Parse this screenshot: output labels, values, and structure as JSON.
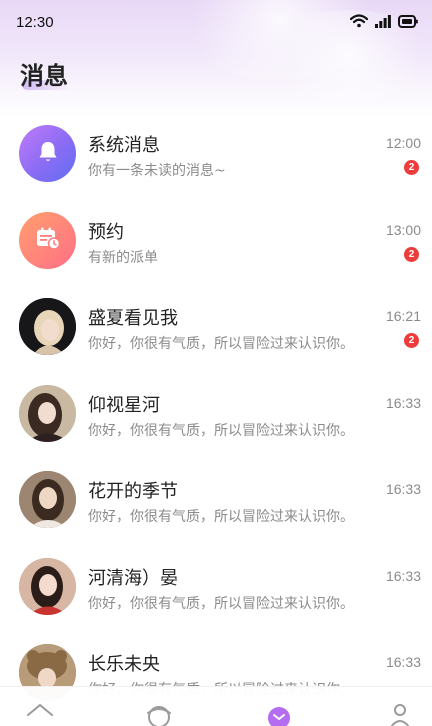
{
  "status_bar": {
    "time": "12:30"
  },
  "page": {
    "title": "消息"
  },
  "messages": [
    {
      "name": "系统消息",
      "preview": "你有一条未读的消息~",
      "time": "12:00",
      "badge": "2",
      "avatar": "bell-icon"
    },
    {
      "name": "预约",
      "preview": "有新的派单",
      "time": "13:00",
      "badge": "2",
      "avatar": "calendar-icon"
    },
    {
      "name": "盛夏看见我",
      "preview": "你好，你很有气质，所以冒险过来认识你。",
      "time": "16:21",
      "badge": "2",
      "avatar": "user-photo"
    },
    {
      "name": "仰视星河",
      "preview": "你好，你很有气质，所以冒险过来认识你。",
      "time": "16:33",
      "avatar": "user-photo"
    },
    {
      "name": "花开的季节",
      "preview": "你好，你很有气质，所以冒险过来认识你。",
      "time": "16:33",
      "avatar": "user-photo"
    },
    {
      "name": "河清海）晏",
      "preview": "你好，你很有气质，所以冒险过来认识你。",
      "time": "16:33",
      "avatar": "user-photo"
    },
    {
      "name": "长乐未央",
      "preview": "你好，你很有气质，所以冒险过来认识你。",
      "time": "16:33",
      "avatar": "user-photo"
    }
  ],
  "tab_bar": {
    "icons": [
      "home-icon",
      "discover-icon",
      "message-icon",
      "profile-icon"
    ],
    "active_color": "#b46cf0"
  },
  "colors": {
    "badge": "#ee3c3c",
    "system_avatar": "#8a6cf5",
    "booking_avatar": "#ff6f86"
  }
}
